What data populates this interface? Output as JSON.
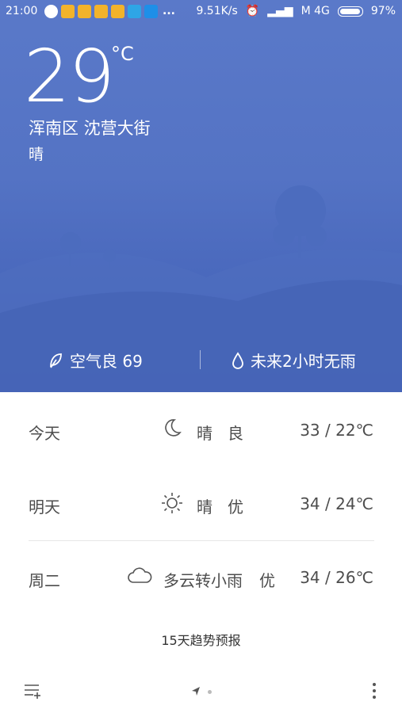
{
  "status_bar": {
    "time": "21:00",
    "more": "...",
    "speed": "9.51K/s",
    "carrier": "M 4G",
    "battery": "97%"
  },
  "weather": {
    "temperature": "29",
    "unit": "°C",
    "location": "浑南区  沈营大街",
    "condition": "晴"
  },
  "air": {
    "aqi_label": "空气良 69",
    "rain_label": "未来2小时无雨"
  },
  "forecast": [
    {
      "day": "今天",
      "icon": "moon-icon",
      "desc": "晴",
      "aq": "良",
      "range": "33 / 22℃"
    },
    {
      "day": "明天",
      "icon": "sun-icon",
      "desc": "晴",
      "aq": "优",
      "range": "34 / 24℃"
    },
    {
      "day": "周二",
      "icon": "cloud-icon",
      "desc": "多云转小雨",
      "aq": "优",
      "range": "34 / 26℃"
    }
  ],
  "trend_label": "15天趋势预报",
  "colors": {
    "hero_top": "#5a79c9",
    "hero_bottom": "#3f5fb2",
    "text_dark": "#4d4d4d"
  }
}
